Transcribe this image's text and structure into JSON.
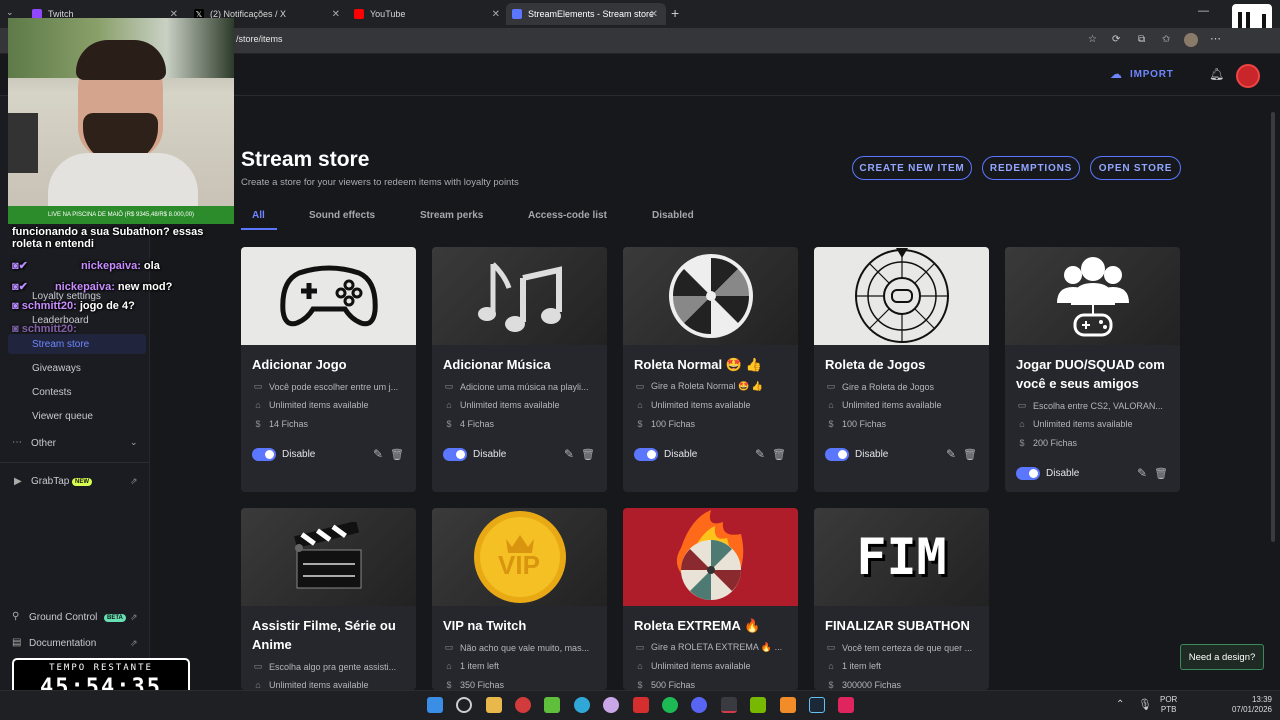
{
  "browser": {
    "tabs": [
      {
        "label": "Twitch",
        "favicon_color": "#9146ff"
      },
      {
        "label": "(2) Notificações / X",
        "favicon_color": "#000000"
      },
      {
        "label": "YouTube",
        "favicon_color": "#ff0000"
      },
      {
        "label": "StreamElements - Stream store",
        "favicon_color": "#5b77ff"
      }
    ],
    "url": "/store/items"
  },
  "header": {
    "import_label": "IMPORT"
  },
  "overlay": {
    "live_text": "LIVE NA PISCINA DE MAIÔ (R$ 9345,48/R$ 8.000,00)",
    "chat": [
      {
        "user": "",
        "text": "funcionando a sua Subathon? essas roleta n entendi"
      },
      {
        "user": "nickepaiva:",
        "text": "ola"
      },
      {
        "user": "nickepaiva:",
        "text": "new mod?"
      },
      {
        "user": "schmitt20:",
        "text": "jogo de 4?"
      },
      {
        "user": "schmitt20:",
        "text": ""
      }
    ],
    "timer_label": "TEMPO RESTANTE",
    "timer_value": "45:54:35"
  },
  "sidebar": {
    "items": [
      {
        "label": "Loyalty settings"
      },
      {
        "label": "Leaderboard"
      },
      {
        "label": "Stream store"
      },
      {
        "label": "Giveaways"
      },
      {
        "label": "Contests"
      },
      {
        "label": "Viewer queue"
      }
    ],
    "other_label": "Other",
    "grabtap_label": "GrabTap",
    "new_badge": "NEW",
    "ground_control_label": "Ground Control",
    "beta_badge": "BETA",
    "documentation_label": "Documentation"
  },
  "main": {
    "title": "Stream store",
    "subtitle": "Create a store for your viewers to redeem items with loyalty points",
    "buttons": {
      "create": "CREATE NEW ITEM",
      "redemptions": "REDEMPTIONS",
      "open_store": "OPEN STORE"
    },
    "tabs": [
      "All",
      "Sound effects",
      "Stream perks",
      "Access-code list",
      "Disabled"
    ],
    "toggle_label": "Disable",
    "cards": [
      {
        "title": "Adicionar Jogo",
        "desc": "Você pode escolher entre um j...",
        "stock": "Unlimited items available",
        "price": "14 Fichas"
      },
      {
        "title": "Adicionar Música",
        "desc": "Adicione uma música na playli...",
        "stock": "Unlimited items available",
        "price": "4 Fichas"
      },
      {
        "title": "Roleta Normal 🤩 👍",
        "desc": "Gire a Roleta Normal 🤩 👍",
        "stock": "Unlimited items available",
        "price": "100 Fichas"
      },
      {
        "title": "Roleta de Jogos",
        "desc": "Gire a Roleta de Jogos",
        "stock": "Unlimited items available",
        "price": "100 Fichas"
      },
      {
        "title": "Jogar DUO/SQUAD com você e seus amigos",
        "desc": "Escolha entre CS2, VALORAN...",
        "stock": "Unlimited items available",
        "price": "200 Fichas"
      },
      {
        "title": "Assistir Filme, Série ou Anime",
        "desc": "Escolha algo pra gente assisti...",
        "stock": "Unlimited items available",
        "price": ""
      },
      {
        "title": "VIP na Twitch",
        "desc": "Não acho que vale muito, mas...",
        "stock": "1 item left",
        "price": "350 Fichas"
      },
      {
        "title": "Roleta EXTREMA 🔥",
        "desc": "Gire a ROLETA EXTREMA 🔥 ...",
        "stock": "Unlimited items available",
        "price": "500 Fichas"
      },
      {
        "title": "FINALIZAR SUBATHON",
        "desc": "Você tem certeza de que quer ...",
        "stock": "1 item left",
        "price": "300000 Fichas"
      }
    ],
    "vip_text": "VIP",
    "fim_text": "FIM",
    "need_design": "Need a design?"
  },
  "taskbar": {
    "lang_top": "POR",
    "lang_bottom": "PTB",
    "time": "13:39",
    "date": "07/01/2026"
  },
  "colors": {
    "accent": "#5b77ff",
    "background": "#17181c",
    "card": "#26272d"
  }
}
